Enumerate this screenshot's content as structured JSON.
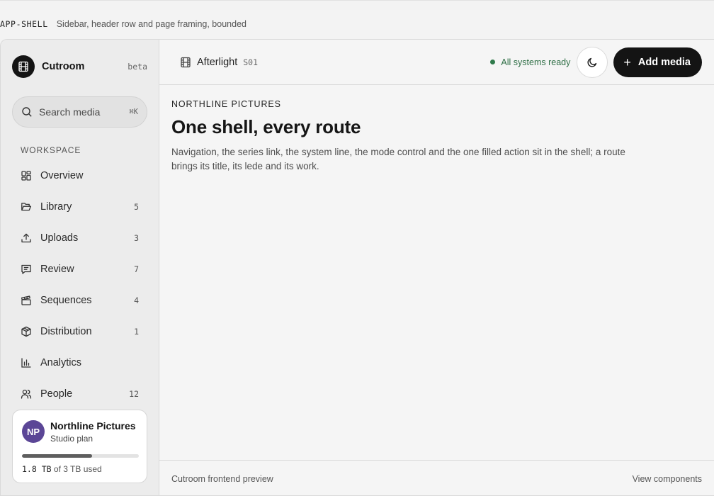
{
  "spec": {
    "name": "APP-SHELL",
    "description": "Sidebar, header row and page framing, bounded"
  },
  "brand": {
    "name": "Cutroom",
    "badge": "beta",
    "icon": "film-icon"
  },
  "search": {
    "placeholder": "Search media",
    "shortcut": "⌘K"
  },
  "sidebar": {
    "section_label": "WORKSPACE",
    "items": [
      {
        "label": "Overview",
        "count": "",
        "icon": "dashboard-icon"
      },
      {
        "label": "Library",
        "count": "5",
        "icon": "folder-icon"
      },
      {
        "label": "Uploads",
        "count": "3",
        "icon": "upload-icon"
      },
      {
        "label": "Review",
        "count": "7",
        "icon": "message-icon"
      },
      {
        "label": "Sequences",
        "count": "4",
        "icon": "clapperboard-icon"
      },
      {
        "label": "Distribution",
        "count": "1",
        "icon": "package-icon"
      },
      {
        "label": "Analytics",
        "count": "",
        "icon": "bar-chart-icon"
      },
      {
        "label": "People",
        "count": "12",
        "icon": "users-icon"
      }
    ]
  },
  "org": {
    "initials": "NP",
    "name": "Northline Pictures",
    "plan": "Studio plan",
    "usage_value": "1.8 TB",
    "usage_suffix": "of 3 TB used",
    "usage_fraction": 0.6,
    "avatar_color": "#5b4696"
  },
  "header": {
    "series_title": "Afterlight",
    "series_code": "S01",
    "status": "All systems ready",
    "status_color": "#2f7a4b",
    "mode_icon": "moon-icon",
    "add_label": "Add media"
  },
  "main": {
    "eyebrow": "NORTHLINE PICTURES",
    "title": "One shell, every route",
    "lede": "Navigation, the series link, the system line, the mode control and the one filled action sit in the shell; a route brings its title, its lede and its work."
  },
  "footer": {
    "left": "Cutroom frontend preview",
    "right": "View components"
  }
}
